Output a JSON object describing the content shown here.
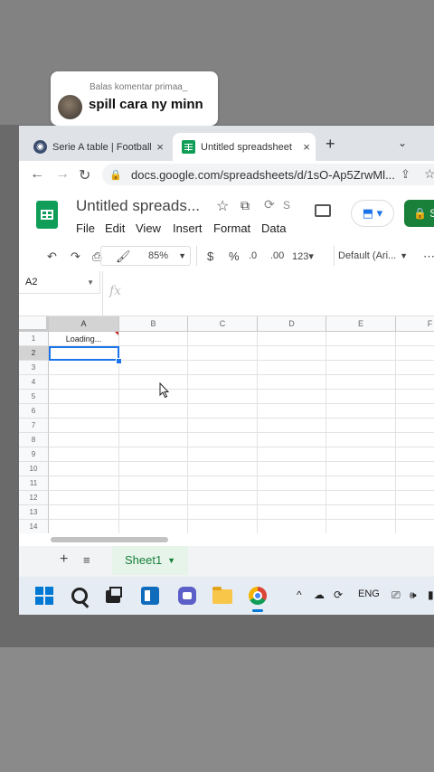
{
  "comment": {
    "reply_label": "Balas komentar primaa_",
    "text": "spill cara ny minn"
  },
  "browser": {
    "tabs": [
      {
        "label": "Serie A table | Football",
        "close": "×"
      },
      {
        "label": "Untitled spreadsheet",
        "close": "×"
      }
    ],
    "new_tab": "+",
    "tab_menu": "⌄",
    "url": "docs.google.com/spreadsheets/d/1sO-Ap5ZrwMl..."
  },
  "doc": {
    "title": "Untitled spreads...",
    "s_fragment": "S",
    "menus": [
      "File",
      "Edit",
      "View",
      "Insert",
      "Format",
      "Data"
    ],
    "share_label": "S"
  },
  "toolbar": {
    "zoom": "85%",
    "currency": "$",
    "percent": "%",
    "decrease_decimal": ".0",
    "increase_decimal": ".00",
    "format_more": "123",
    "font": "Default (Ari..."
  },
  "formula_bar": {
    "name_box": "A2",
    "fx": "fx"
  },
  "grid": {
    "columns": [
      "A",
      "B",
      "C",
      "D",
      "E",
      "F"
    ],
    "rows": [
      "1",
      "2",
      "3",
      "4",
      "5",
      "6",
      "7",
      "8",
      "9",
      "10",
      "11",
      "12",
      "13",
      "14"
    ],
    "cell_a1": "Loading..."
  },
  "sheets": {
    "add": "+",
    "list": "≡",
    "tabs": [
      "Sheet1"
    ]
  },
  "taskbar": {
    "lang": "ENG",
    "tray_caret": "^"
  },
  "colors": {
    "sheets_green": "#0f9d58",
    "selection_blue": "#1a73e8",
    "share_green": "#188038"
  }
}
